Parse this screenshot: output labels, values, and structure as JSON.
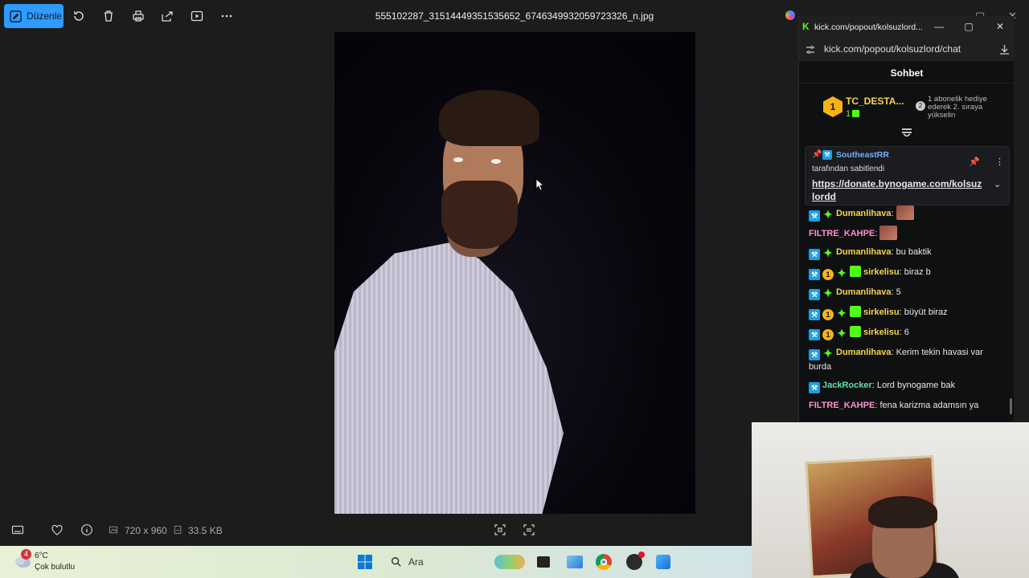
{
  "photos_app": {
    "edit_button": "Düzenle",
    "file_name": "555102287_31514449351535652_6746349932059723326_n.jpg",
    "dimensions": "720 x 960",
    "file_size": "33.5 KB"
  },
  "taskbar": {
    "weather_badge": "4",
    "weather_temp": "6°C",
    "weather_desc": "Çok bulutlu",
    "search_placeholder": "Ara"
  },
  "chat_window": {
    "tab_title": "kick.com/popout/kolsuzlord...",
    "url": "kick.com/popout/kolsuzlord/chat",
    "header": "Sohbet",
    "leader": {
      "rank": "1",
      "name": "TC_DESTA...",
      "count": "1",
      "rank2": "2",
      "hint": "1 abonelik hediye ederek 2. sıraya yükselin"
    },
    "pinned": {
      "author": "SoutheastRR",
      "subtitle": "tarafından sabitlendi",
      "link": "https://donate.bynogame.com/kolsuzlordd"
    },
    "messages": [
      {
        "user": "Dumanlihava",
        "text": "",
        "color": "#f5d64a",
        "mod": true,
        "vip": true,
        "gold": false,
        "gift": false,
        "emote": true
      },
      {
        "user": "FILTRE_KAHPE",
        "text": "",
        "color": "#ff8fd0",
        "mod": false,
        "vip": false,
        "gold": false,
        "gift": false,
        "emote": true
      },
      {
        "user": "Dumanlihava",
        "text": "bu baktik",
        "color": "#f5d64a",
        "mod": true,
        "vip": true,
        "gold": false,
        "gift": false,
        "emote": false
      },
      {
        "user": "sirkelisu",
        "text": "biraz b",
        "color": "#f5d64a",
        "mod": true,
        "vip": true,
        "gold": true,
        "gift": true,
        "emote": false
      },
      {
        "user": "Dumanlihava",
        "text": "5",
        "color": "#f5d64a",
        "mod": true,
        "vip": true,
        "gold": false,
        "gift": false,
        "emote": false
      },
      {
        "user": "sirkelisu",
        "text": "büyüt biraz",
        "color": "#f5d64a",
        "mod": true,
        "vip": true,
        "gold": true,
        "gift": true,
        "emote": false
      },
      {
        "user": "sirkelisu",
        "text": "6",
        "color": "#f5d64a",
        "mod": true,
        "vip": true,
        "gold": true,
        "gift": true,
        "emote": false
      },
      {
        "user": "Dumanlihava",
        "text": "Kerim tekin havasi var burda",
        "color": "#f5d64a",
        "mod": true,
        "vip": true,
        "gold": false,
        "gift": false,
        "emote": false
      },
      {
        "user": "JackRocker",
        "text": "Lord bynogame bak",
        "color": "#5ee0a8",
        "mod": true,
        "vip": false,
        "gold": false,
        "gift": false,
        "emote": false
      },
      {
        "user": "FILTRE_KAHPE",
        "text": "fena karizma adamsın ya",
        "color": "#ff8fd0",
        "mod": false,
        "vip": false,
        "gold": false,
        "gift": false,
        "emote": false
      }
    ],
    "gold_badge_label": "1"
  }
}
